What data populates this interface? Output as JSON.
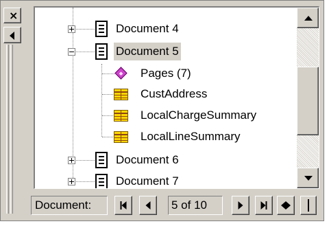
{
  "window": {
    "close_glyph": "×"
  },
  "tree": {
    "nodes": [
      {
        "label": "Document 4",
        "icon": "document-icon",
        "expander": "plus"
      },
      {
        "label": "Document 5",
        "icon": "document-icon",
        "expander": "minus",
        "selected": true
      },
      {
        "label": "Pages (7)",
        "icon": "pages-icon"
      },
      {
        "label": "CustAddress",
        "icon": "table-icon"
      },
      {
        "label": "LocalChargeSummary",
        "icon": "table-icon"
      },
      {
        "label": "LocalLineSummary",
        "icon": "table-icon"
      },
      {
        "label": "Document 6",
        "icon": "document-icon",
        "expander": "plus"
      },
      {
        "label": "Document 7",
        "icon": "document-icon",
        "expander": "plus"
      }
    ]
  },
  "navigation": {
    "label": "Document:",
    "record": "5 of 10"
  },
  "colors": {
    "face": "#d4d0c8",
    "selected_background": "#d4d0c8",
    "table_icon": "#ffd800",
    "pages_icon": "#cc44cc"
  }
}
